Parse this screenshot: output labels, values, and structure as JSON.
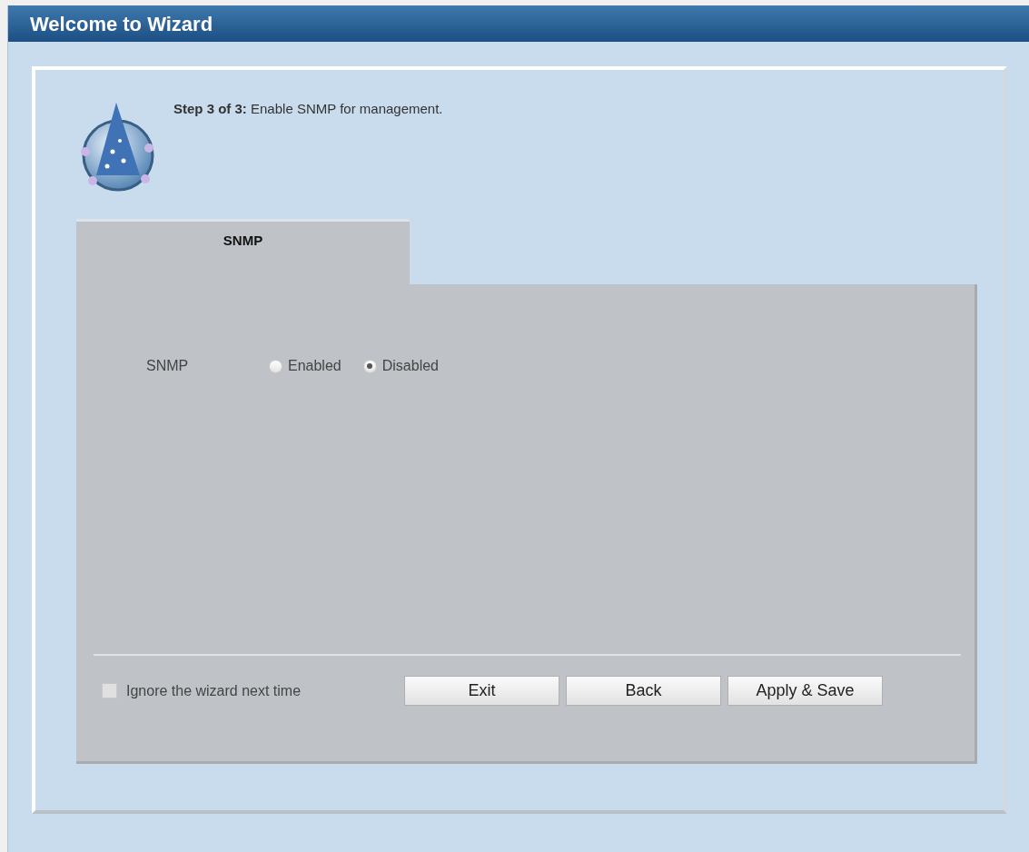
{
  "window": {
    "title": "Welcome to Wizard"
  },
  "step": {
    "text": "**Step 3 of 3:** Enable SNMP for management."
  },
  "tabs": [
    {
      "label": "SNMP",
      "selected": true
    }
  ],
  "snmp": {
    "label": "SNMP",
    "options": [
      {
        "label": "Enabled",
        "selected": false
      },
      {
        "label": "Disabled",
        "selected": true
      }
    ]
  },
  "ignore": {
    "label": "Ignore the wizard next time",
    "checked": false
  },
  "buttons": [
    "Exit",
    "Back",
    "Apply & Save"
  ]
}
